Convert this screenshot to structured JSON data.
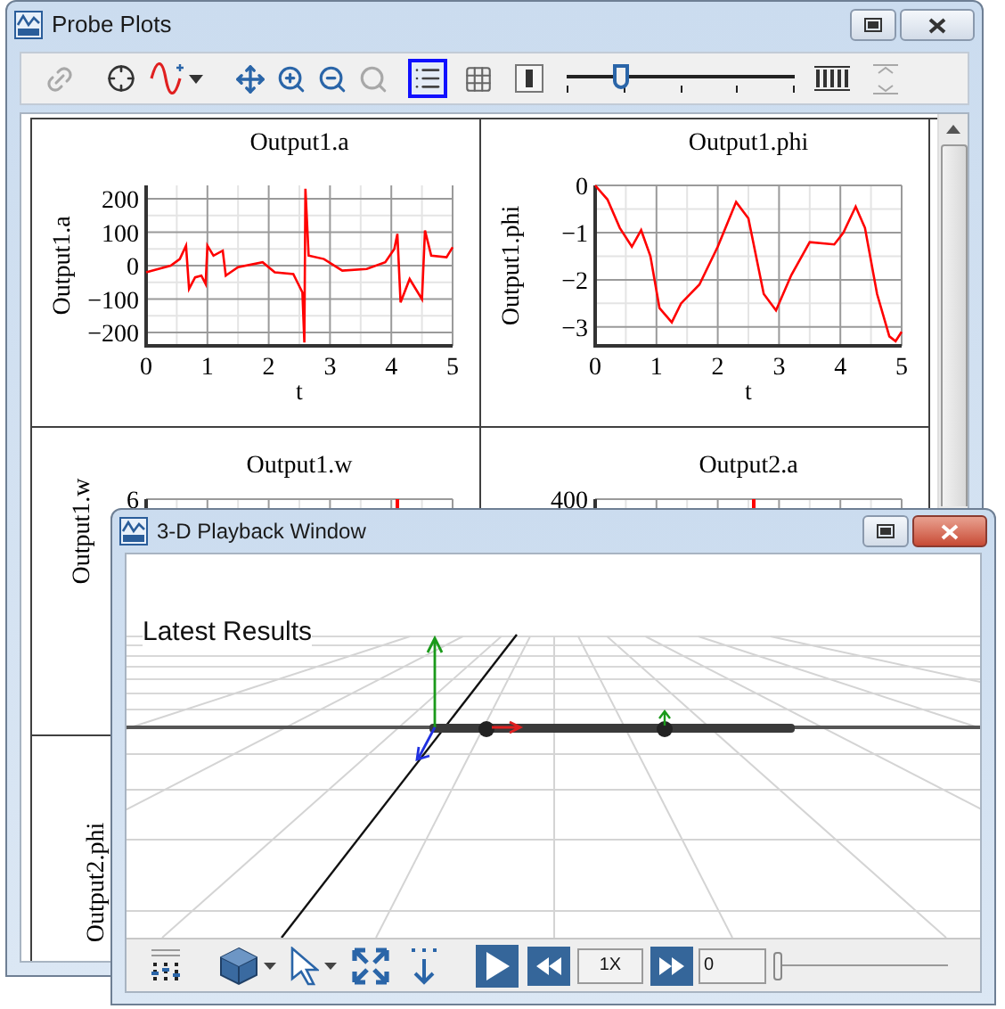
{
  "probe_window": {
    "title": "Probe Plots",
    "toolbar": {
      "buttons": [
        {
          "selected": false,
          "disabled": true
        },
        {
          "selected": false,
          "disabled": false
        },
        {
          "selected": false,
          "disabled": false
        },
        {
          "selected": false,
          "disabled": false
        },
        {
          "selected": false,
          "disabled": false
        },
        {
          "selected": false,
          "disabled": false
        },
        {
          "selected": false,
          "disabled": true
        },
        {
          "selected": true,
          "disabled": false
        },
        {
          "selected": false,
          "disabled": false
        },
        {
          "selected": false,
          "disabled": false
        },
        {
          "selected": false,
          "disabled": false
        },
        {
          "selected": false,
          "disabled": true
        }
      ],
      "slider": {
        "level": 0.24
      }
    },
    "plots": [
      {
        "kind": "chart",
        "chart_data": {
          "type": "line",
          "grid": true,
          "title": "Output1.a",
          "xlabel": "t",
          "ylabel": "Output1.a",
          "x": [
            0,
            0.2,
            0.4,
            0.55,
            0.65,
            0.7,
            0.8,
            0.9,
            0.97,
            1.0,
            1.1,
            1.25,
            1.3,
            1.5,
            1.9,
            2.1,
            2.4,
            2.55,
            2.58,
            2.6,
            2.65,
            2.9,
            3.2,
            3.6,
            3.9,
            4.05,
            4.1,
            4.15,
            4.3,
            4.5,
            4.55,
            4.65,
            4.9,
            5.0
          ],
          "series": [
            {
              "color": "#ff0000",
              "values": [
                -20,
                -10,
                0,
                20,
                60,
                -70,
                -35,
                -30,
                -55,
                60,
                30,
                45,
                -30,
                -5,
                10,
                -20,
                -25,
                -80,
                -230,
                230,
                30,
                20,
                -15,
                -10,
                10,
                50,
                95,
                -110,
                -40,
                -100,
                105,
                30,
                25,
                55
              ]
            }
          ],
          "xlim": [
            0,
            5
          ],
          "ylim": [
            -240,
            240
          ],
          "xticks": [
            0,
            1,
            2,
            3,
            4,
            5
          ],
          "yticks": [
            {
              "value": 200,
              "label": "200"
            },
            {
              "value": 100,
              "label": "100"
            },
            {
              "value": 0,
              "label": "0"
            },
            {
              "value": -100,
              "label": "−100"
            },
            {
              "value": -200,
              "label": "−200"
            }
          ]
        }
      },
      {
        "kind": "chart",
        "chart_data": {
          "type": "line",
          "grid": true,
          "title": "Output1.phi",
          "xlabel": "t",
          "ylabel": "Output1.phi",
          "x": [
            0,
            0.2,
            0.4,
            0.6,
            0.75,
            0.9,
            1.05,
            1.25,
            1.4,
            1.7,
            2.0,
            2.3,
            2.5,
            2.75,
            2.95,
            3.2,
            3.5,
            3.9,
            4.05,
            4.25,
            4.4,
            4.6,
            4.8,
            4.9,
            5.0
          ],
          "series": [
            {
              "color": "#ff0000",
              "values": [
                0,
                -0.3,
                -0.9,
                -1.3,
                -0.95,
                -1.5,
                -2.6,
                -2.9,
                -2.5,
                -2.1,
                -1.3,
                -0.35,
                -0.7,
                -2.3,
                -2.65,
                -1.9,
                -1.2,
                -1.25,
                -1.0,
                -0.45,
                -0.9,
                -2.3,
                -3.2,
                -3.3,
                -3.1
              ]
            }
          ],
          "xlim": [
            0,
            5
          ],
          "ylim": [
            -3.4,
            0
          ],
          "xticks": [
            0,
            1,
            2,
            3,
            4,
            5
          ],
          "yticks": [
            {
              "value": 0,
              "label": "0"
            },
            {
              "value": -1,
              "label": "−1"
            },
            {
              "value": -2,
              "label": "−2"
            },
            {
              "value": -3,
              "label": "−3"
            }
          ]
        }
      },
      {
        "kind": "partial",
        "title": "Output1.w",
        "ylabel": "Output1.w",
        "top_tick": "6"
      },
      {
        "kind": "partial",
        "title": "Output2.a",
        "top_tick": "400"
      },
      {
        "kind": "partial",
        "ylabel": "Output2.phi"
      }
    ]
  },
  "playback_window": {
    "title": "3-D Playback Window",
    "caption": "Latest Results",
    "speed": "1X",
    "frame": "0",
    "slider": {
      "level": 0
    }
  }
}
